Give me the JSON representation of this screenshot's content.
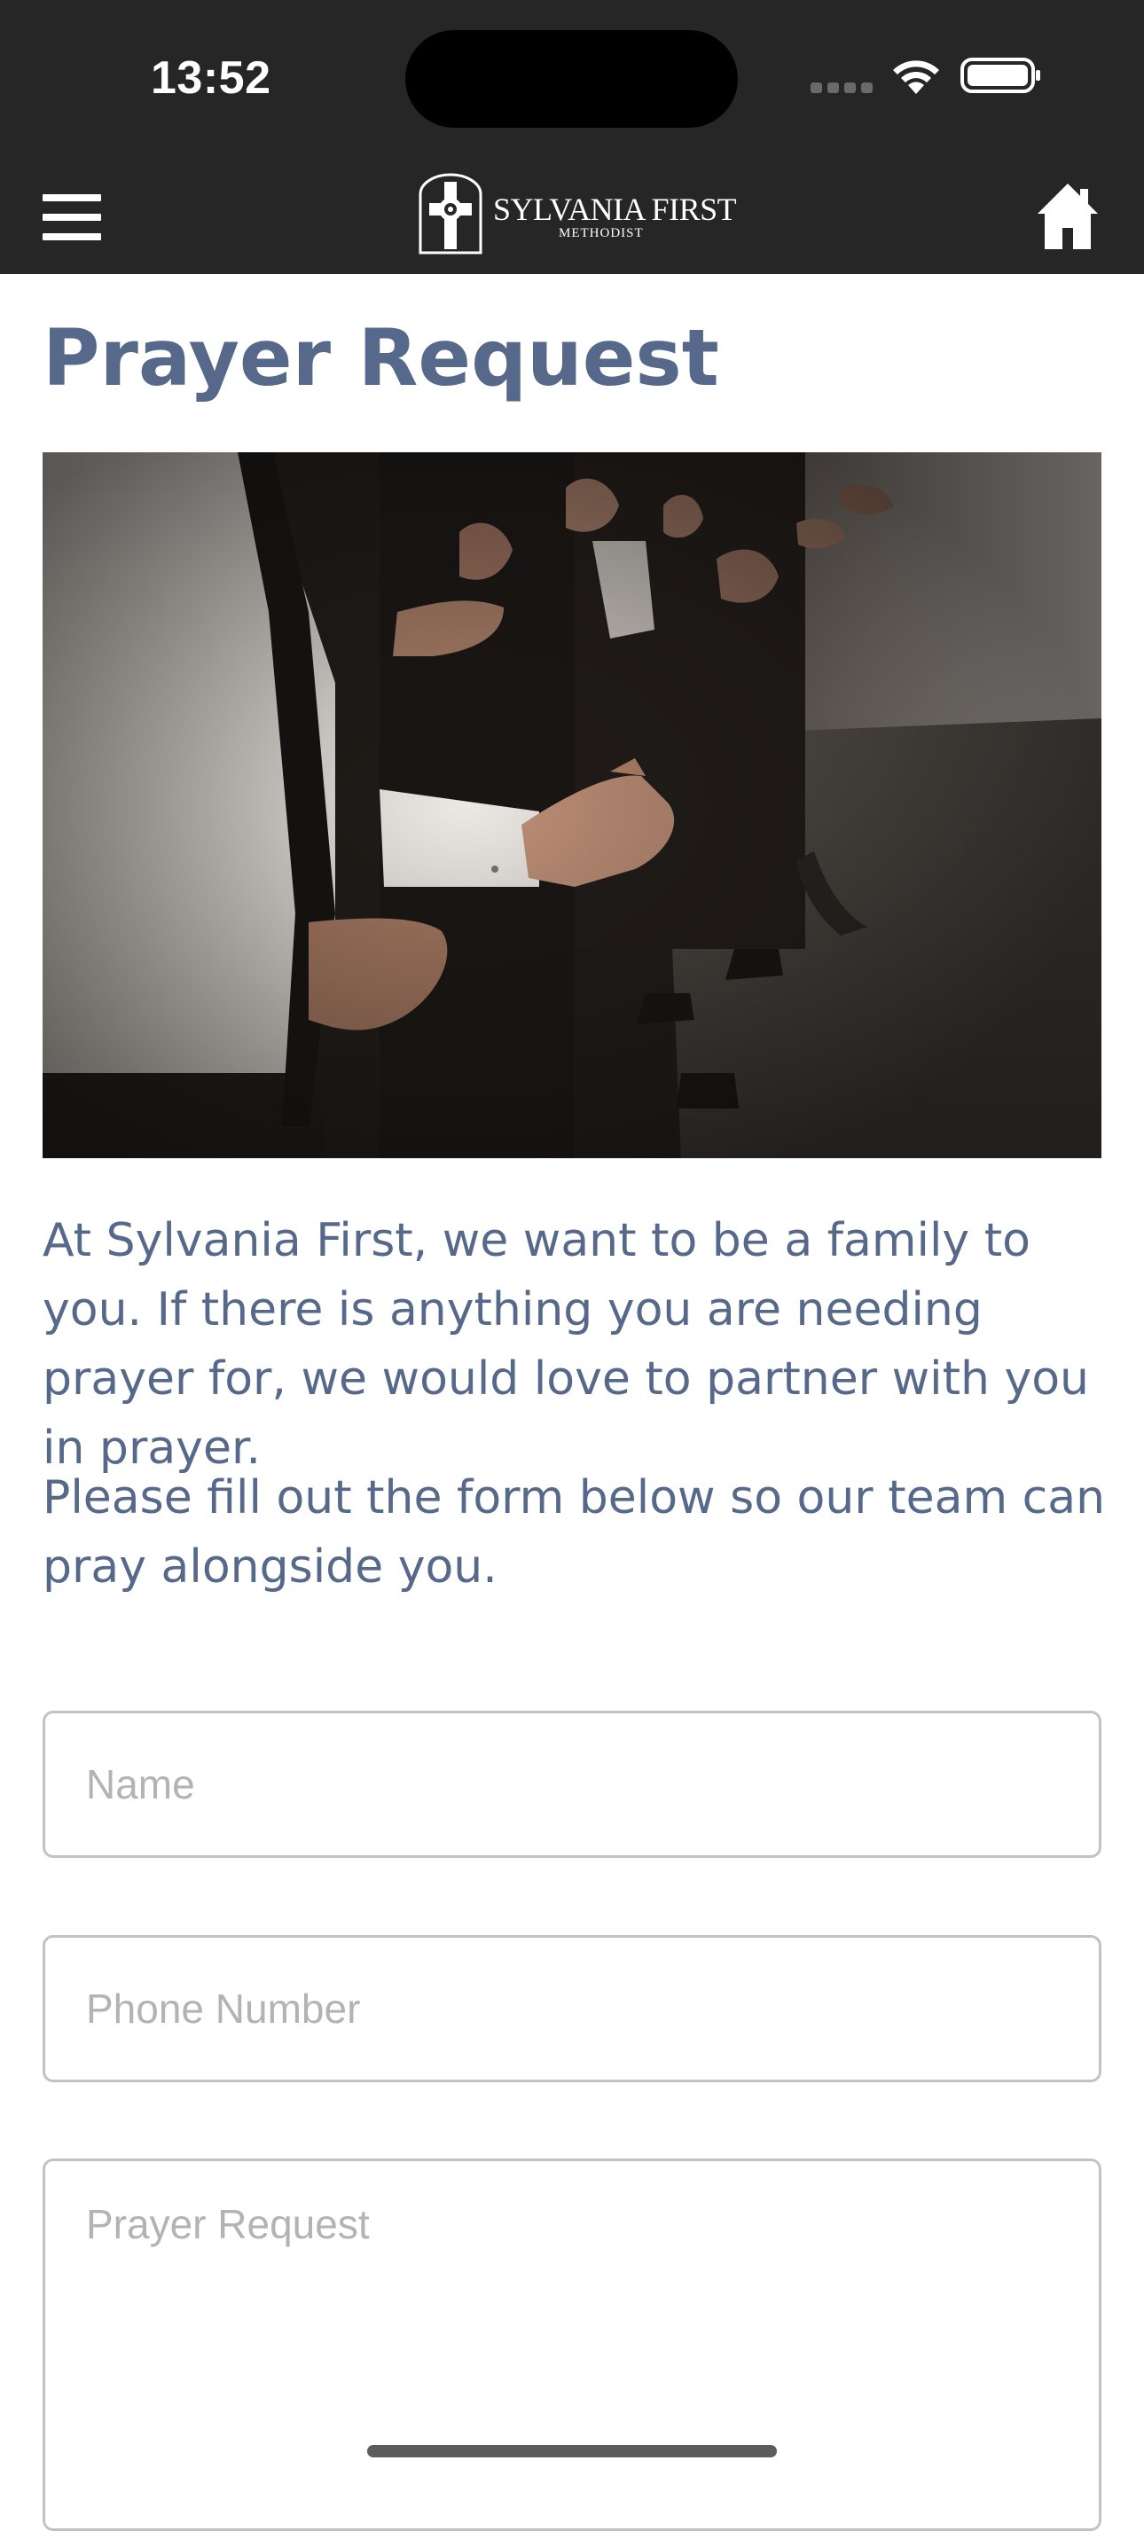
{
  "status_bar": {
    "time": "13:52"
  },
  "header": {
    "logo_name": "SYLVANIA FIRST",
    "logo_subtitle": "METHODIST",
    "menu_icon": "hamburger-menu-icon",
    "home_icon": "home-icon"
  },
  "page": {
    "title": "Prayer Request",
    "intro_paragraph_1": "At Sylvania First, we want to be a family to you. If there is anything you are needing prayer for, we would love to partner with you in prayer.",
    "intro_paragraph_2": "Please fill out the form below so our team can pray alongside you."
  },
  "form": {
    "name_placeholder": "Name",
    "name_value": "",
    "phone_placeholder": "Phone Number",
    "phone_value": "",
    "prayer_placeholder": "Prayer Request",
    "prayer_value": ""
  },
  "colors": {
    "header_background": "#262626",
    "accent_text": "#56698a",
    "field_border": "#c2c2c2",
    "placeholder": "#b3b3b3"
  }
}
